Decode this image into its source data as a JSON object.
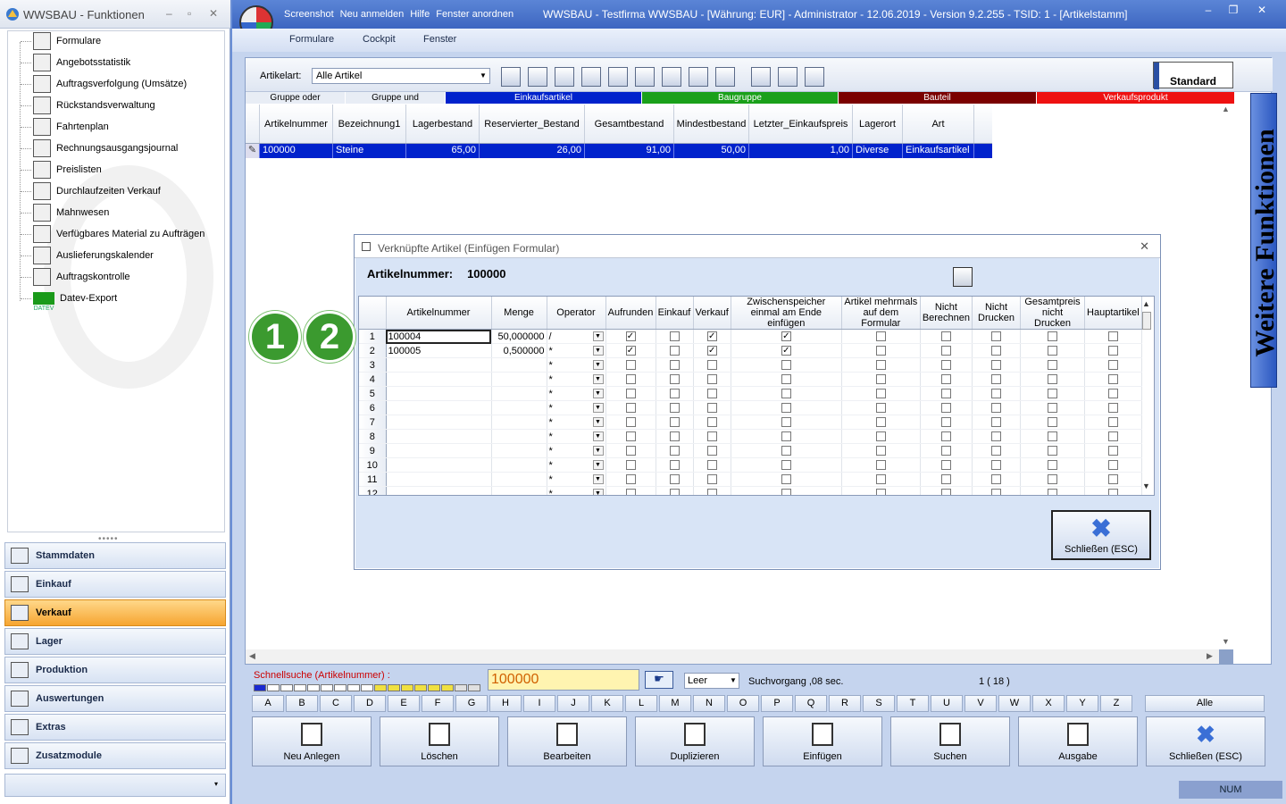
{
  "left": {
    "title": "WWSBAU - Funktionen",
    "tree": [
      {
        "label": "Formulare",
        "icon": "form-icon"
      },
      {
        "label": "Angebotsstatistik",
        "icon": "calendar-icon"
      },
      {
        "label": "Auftragsverfolgung (Umsätze)",
        "icon": "tracking-icon"
      },
      {
        "label": "Rückstandsverwaltung",
        "icon": "backlog-icon"
      },
      {
        "label": "Fahrtenplan",
        "icon": "truck-icon"
      },
      {
        "label": "Rechnungsausgangsjournal",
        "icon": "journal-icon"
      },
      {
        "label": "Preislisten",
        "icon": "tag-icon"
      },
      {
        "label": "Durchlaufzeiten Verkauf",
        "icon": "hourglass-icon"
      },
      {
        "label": "Mahnwesen",
        "icon": "dunning-icon"
      },
      {
        "label": "Verfügbares Material zu Aufträgen",
        "icon": "material-icon"
      },
      {
        "label": "Auslieferungskalender",
        "icon": "delivery-calendar-icon"
      },
      {
        "label": "Auftragskontrolle",
        "icon": "order-control-icon"
      },
      {
        "label": "Datev-Export",
        "icon": "datev-icon",
        "icon_text": "DATEV"
      }
    ],
    "nav": [
      {
        "label": "Stammdaten",
        "active": false
      },
      {
        "label": "Einkauf",
        "active": false
      },
      {
        "label": "Verkauf",
        "active": true
      },
      {
        "label": "Lager",
        "active": false
      },
      {
        "label": "Produktion",
        "active": false
      },
      {
        "label": "Auswertungen",
        "active": false
      },
      {
        "label": "Extras",
        "active": false
      },
      {
        "label": "Zusatzmodule",
        "active": false
      }
    ]
  },
  "main": {
    "menu": [
      "Screenshot",
      "Neu anmelden",
      "Hilfe",
      "Fenster anordnen"
    ],
    "title": "WWSBAU - Testfirma WWSBAU - [Währung: EUR] - Administrator - 12.06.2019 - Version 9.2.255 - TSID: 1 - [Artikelstamm]",
    "ribbon": [
      "Formulare",
      "Cockpit",
      "Fenster"
    ],
    "artikelart_label": "Artikelart:",
    "artikelart_value": "Alle Artikel",
    "standard_label": "Standard",
    "legend": [
      {
        "label": "Gruppe oder",
        "color": "#e8edf5",
        "text": "#000"
      },
      {
        "label": "Gruppe und",
        "color": "#e8edf5",
        "text": "#000"
      },
      {
        "label": "Einkaufsartikel",
        "color": "#0022cc",
        "text": "#fff"
      },
      {
        "label": "Baugruppe",
        "color": "#1aa01a",
        "text": "#fff"
      },
      {
        "label": "Bauteil",
        "color": "#7a0000",
        "text": "#fff"
      },
      {
        "label": "Verkaufsprodukt",
        "color": "#ee1111",
        "text": "#fff"
      }
    ],
    "columns": [
      "Artikelnummer",
      "Bezeichnung1",
      "Lagerbestand",
      "Reservierter_Bestand",
      "Gesamtbestand",
      "Mindestbestand",
      "Letzter_Einkaufspreis",
      "Lagerort",
      "Art"
    ],
    "rows": [
      [
        "100000",
        "Steine",
        "65,00",
        "26,00",
        "91,00",
        "50,00",
        "1,00",
        "Diverse",
        "Einkaufsartikel"
      ]
    ],
    "side_tab": "Weitere Funktionen"
  },
  "bottom": {
    "schnellsuche_label": "Schnellsuche (Artikelnummer) :",
    "search_value": "100000",
    "leer_value": "Leer",
    "suchvorgang": "Suchvorgang ,08 sec.",
    "count": "1  ( 18 )",
    "letters": [
      "A",
      "B",
      "C",
      "D",
      "E",
      "F",
      "G",
      "H",
      "I",
      "J",
      "K",
      "L",
      "M",
      "N",
      "O",
      "P",
      "Q",
      "R",
      "S",
      "T",
      "U",
      "V",
      "W",
      "X",
      "Y",
      "Z"
    ],
    "alle": "Alle",
    "actions": [
      "Neu Anlegen",
      "Löschen",
      "Bearbeiten",
      "Duplizieren",
      "Einfügen",
      "Suchen",
      "Ausgabe",
      "Schließen (ESC)"
    ],
    "status_num": "NUM"
  },
  "dialog": {
    "title": "Verknüpfte Artikel (Einfügen Formular)",
    "artnr_label": "Artikelnummer:",
    "artnr_value": "100000",
    "columns": [
      "Artikelnummer",
      "Menge",
      "Operator",
      "Aufrunden",
      "Einkauf",
      "Verkauf",
      "Zwischenspeicher einmal am Ende einfügen",
      "Artikel mehrmals auf dem Formular",
      "Nicht Berechnen",
      "Nicht Drucken",
      "Gesamtpreis nicht Drucken",
      "Hauptartikel"
    ],
    "rows": [
      {
        "n": "1",
        "art": "100004",
        "menge": "50,000000",
        "op": "/",
        "checks": [
          true,
          false,
          true,
          true,
          false,
          false,
          false,
          false,
          false
        ]
      },
      {
        "n": "2",
        "art": "100005",
        "menge": "0,500000",
        "op": "*",
        "checks": [
          true,
          false,
          true,
          true,
          false,
          false,
          false,
          false,
          false
        ]
      },
      {
        "n": "3",
        "art": "",
        "menge": "",
        "op": "*",
        "checks": [
          false,
          false,
          false,
          false,
          false,
          false,
          false,
          false,
          false
        ]
      },
      {
        "n": "4",
        "art": "",
        "menge": "",
        "op": "*",
        "checks": [
          false,
          false,
          false,
          false,
          false,
          false,
          false,
          false,
          false
        ]
      },
      {
        "n": "5",
        "art": "",
        "menge": "",
        "op": "*",
        "checks": [
          false,
          false,
          false,
          false,
          false,
          false,
          false,
          false,
          false
        ]
      },
      {
        "n": "6",
        "art": "",
        "menge": "",
        "op": "*",
        "checks": [
          false,
          false,
          false,
          false,
          false,
          false,
          false,
          false,
          false
        ]
      },
      {
        "n": "7",
        "art": "",
        "menge": "",
        "op": "*",
        "checks": [
          false,
          false,
          false,
          false,
          false,
          false,
          false,
          false,
          false
        ]
      },
      {
        "n": "8",
        "art": "",
        "menge": "",
        "op": "*",
        "checks": [
          false,
          false,
          false,
          false,
          false,
          false,
          false,
          false,
          false
        ]
      },
      {
        "n": "9",
        "art": "",
        "menge": "",
        "op": "*",
        "checks": [
          false,
          false,
          false,
          false,
          false,
          false,
          false,
          false,
          false
        ]
      },
      {
        "n": "10",
        "art": "",
        "menge": "",
        "op": "*",
        "checks": [
          false,
          false,
          false,
          false,
          false,
          false,
          false,
          false,
          false
        ]
      },
      {
        "n": "11",
        "art": "",
        "menge": "",
        "op": "*",
        "checks": [
          false,
          false,
          false,
          false,
          false,
          false,
          false,
          false,
          false
        ]
      },
      {
        "n": "12",
        "art": "",
        "menge": "",
        "op": "*",
        "checks": [
          false,
          false,
          false,
          false,
          false,
          false,
          false,
          false,
          false
        ]
      }
    ],
    "close_label": "Schließen (ESC)"
  },
  "badges": [
    "1",
    "2"
  ]
}
